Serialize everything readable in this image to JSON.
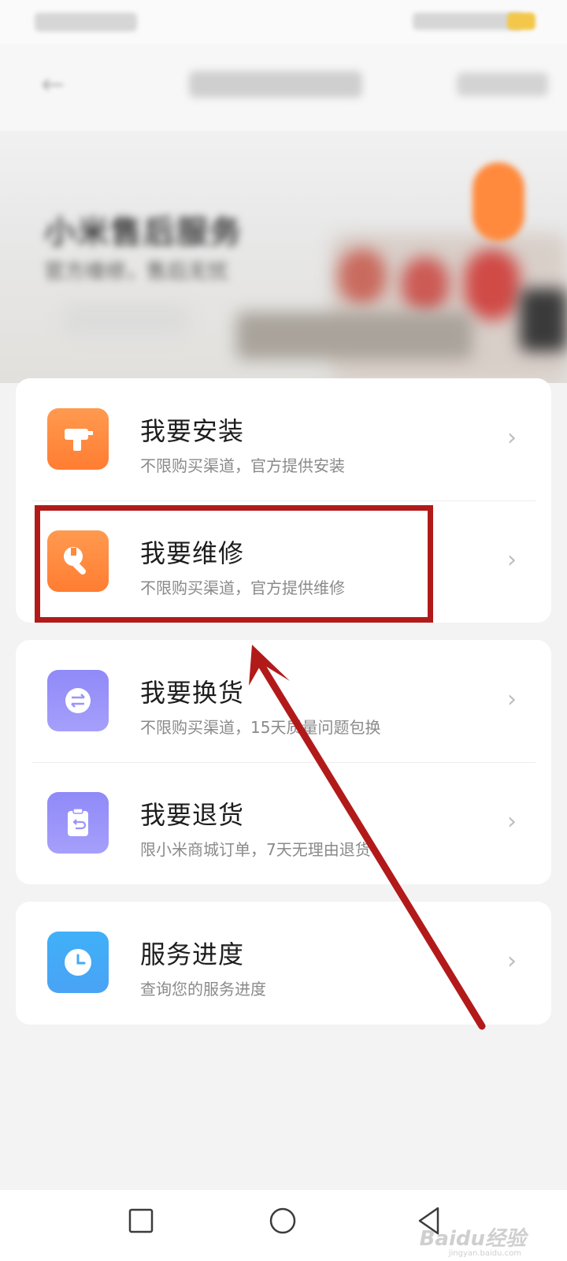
{
  "menu": {
    "install": {
      "title": "我要安装",
      "subtitle": "不限购买渠道，官方提供安装"
    },
    "repair": {
      "title": "我要维修",
      "subtitle": "不限购买渠道，官方提供维修"
    },
    "exchange": {
      "title": "我要换货",
      "subtitle": "不限购买渠道，15天质量问题包换"
    },
    "return": {
      "title": "我要退货",
      "subtitle": "限小米商城订单，7天无理由退货"
    },
    "progress": {
      "title": "服务进度",
      "subtitle": "查询您的服务进度"
    }
  },
  "banner": {
    "heading": "小米售后服务",
    "subheading": "官方维修，售后无忧"
  },
  "watermark": {
    "text": "Baidu经验",
    "url": "jingyan.baidu.com"
  },
  "colors": {
    "annotation": "#b21a1a",
    "orange_icon": "#ff8a3d",
    "purple_icon": "#9a94fa",
    "blue_icon": "#44aaf6"
  }
}
